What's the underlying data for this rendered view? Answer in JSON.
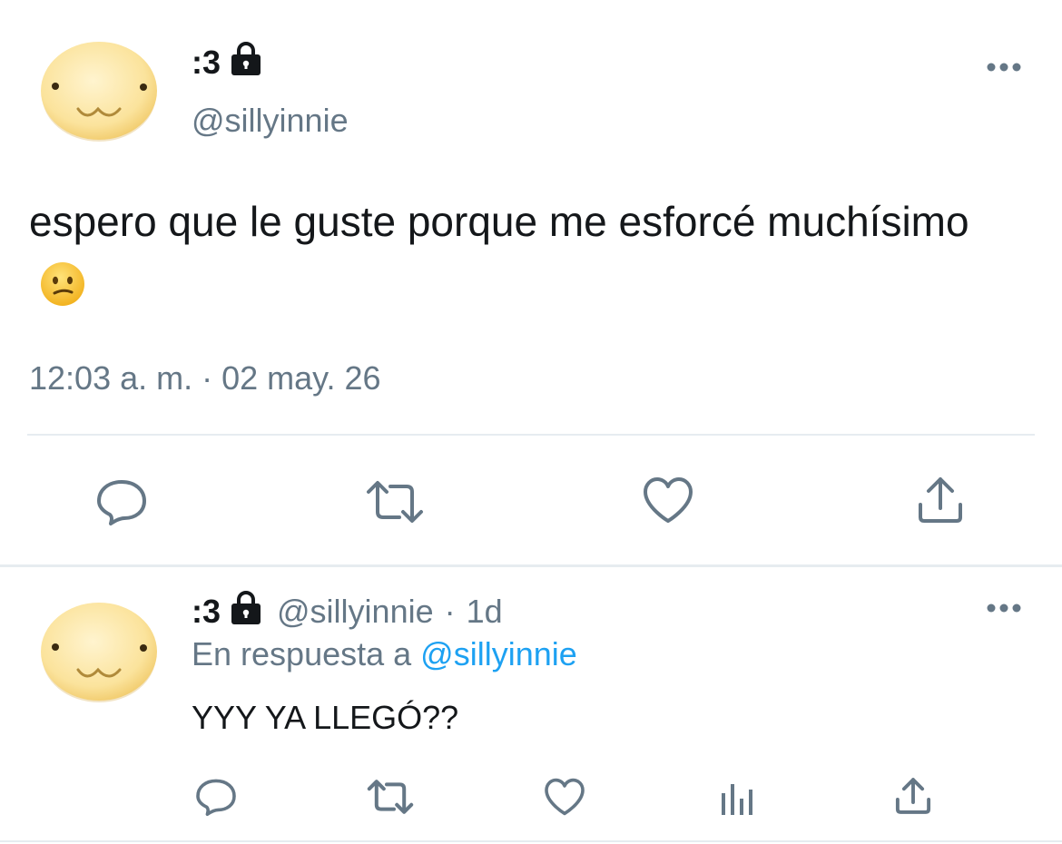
{
  "main_tweet": {
    "display_name": ":3",
    "handle": "@sillyinnie",
    "text": "espero que le guste porque me esforcé muchísimo",
    "emoji": "confused-face",
    "timestamp": "12:03 a. m. · 02 may. 26"
  },
  "reply": {
    "display_name": ":3",
    "handle": "@sillyinnie",
    "separator": "·",
    "age": "1d",
    "reply_prefix": "En respuesta a",
    "reply_to": "@sillyinnie",
    "text": "YYY YA LLEGÓ??"
  },
  "colors": {
    "text": "#14171a",
    "secondary": "#657786",
    "link": "#1da1f2",
    "divider": "#e6ecf0",
    "avatar": "#f7d98a"
  }
}
